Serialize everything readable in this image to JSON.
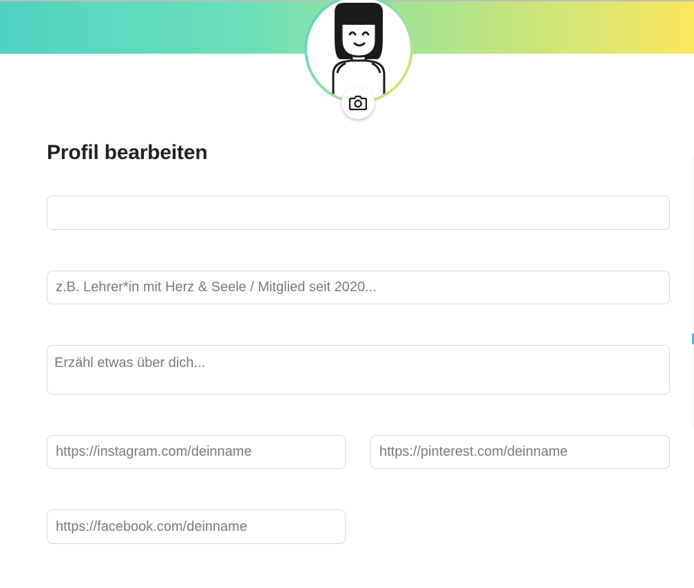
{
  "header": {
    "avatar_icon": "cartoon-girl-avatar",
    "camera_icon": "camera-icon",
    "gradient_colors": [
      "#4fd2c0",
      "#6be0bb",
      "#a6e390",
      "#d6e675",
      "#fae65c"
    ]
  },
  "page": {
    "title": "Profil bearbeiten"
  },
  "form": {
    "name": {
      "value": "",
      "placeholder": ""
    },
    "headline": {
      "value": "",
      "placeholder": "z.B. Lehrer*in mit Herz & Seele / Mitglied seit 2020..."
    },
    "about": {
      "value": "",
      "placeholder": "Erzähl etwas über dich..."
    },
    "instagram": {
      "value": "",
      "placeholder": "https://instagram.com/deinname"
    },
    "pinterest": {
      "value": "",
      "placeholder": "https://pinterest.com/deinname"
    },
    "facebook": {
      "value": "",
      "placeholder": "https://facebook.com/deinname"
    }
  },
  "colors": {
    "field_border": "#d6d6d6",
    "placeholder": "#7a7a7a",
    "title": "#222222"
  }
}
